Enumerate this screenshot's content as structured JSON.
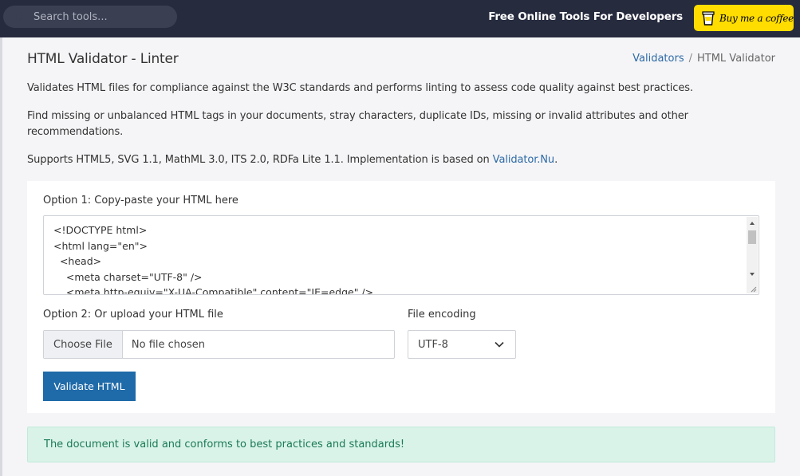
{
  "header": {
    "search_placeholder": "Search tools...",
    "tagline": "Free Online Tools For Developers",
    "coffee_label": "Buy me a coffee",
    "search_icon": "search-icon",
    "coffee_icon": "coffee-cup-icon"
  },
  "page": {
    "title": "HTML Validator - Linter",
    "breadcrumb": {
      "parent": "Validators",
      "separator": "/",
      "current": "HTML Validator"
    },
    "intro_1": "Validates HTML files for compliance against the W3C standards and performs linting to assess code quality against best practices.",
    "intro_2": "Find missing or unbalanced HTML tags in your documents, stray characters, duplicate IDs, missing or invalid attributes and other recommendations.",
    "intro_3_prefix": "Supports HTML5, SVG 1.1, MathML 3.0, ITS 2.0, RDFa Lite 1.1. Implementation is based on ",
    "intro_3_link": "Validator.Nu",
    "intro_3_suffix": "."
  },
  "form": {
    "option1_label": "Option 1: Copy-paste your HTML here",
    "code": "<!DOCTYPE html>\n<html lang=\"en\">\n  <head>\n    <meta charset=\"UTF-8\" />\n    <meta http-equiv=\"X-UA-Compatible\" content=\"IE=edge\" />",
    "option2_label": "Option 2: Or upload your HTML file",
    "choose_file": "Choose File",
    "no_file": "No file chosen",
    "encoding_label": "File encoding",
    "encoding_value": "UTF-8",
    "validate_button": "Validate HTML"
  },
  "result": {
    "message": "The document is valid and conforms to best practices and standards!"
  },
  "colors": {
    "topbar": "#262b3e",
    "accent": "#1f6aa8",
    "coffee": "#ffdd00",
    "success_bg": "#d9f3e9",
    "success_text": "#1b7a55"
  }
}
